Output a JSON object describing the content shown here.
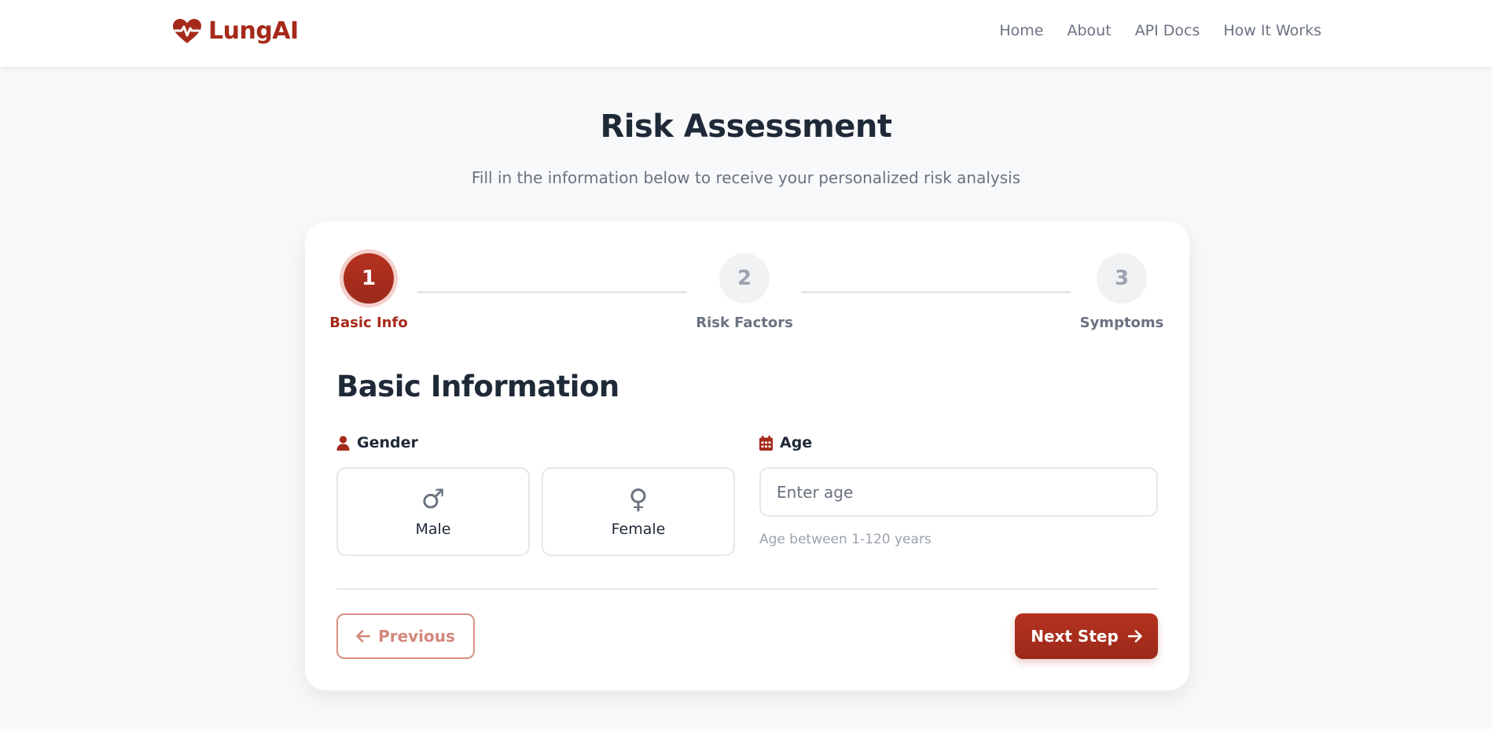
{
  "navbar": {
    "brand": "LungAI",
    "brand_icon": "heart-pulse-icon",
    "brand_color": "#a52a1a",
    "links": [
      {
        "label": "Home"
      },
      {
        "label": "About"
      },
      {
        "label": "API Docs"
      },
      {
        "label": "How It Works"
      }
    ]
  },
  "page": {
    "title": "Risk Assessment",
    "subtitle": "Fill in the information below to receive your personalized risk analysis"
  },
  "stepper": {
    "current_step": 1,
    "steps": [
      {
        "number": "1",
        "label": "Basic Info",
        "state": "active"
      },
      {
        "number": "2",
        "label": "Risk Factors",
        "state": "inactive"
      },
      {
        "number": "3",
        "label": "Symptoms",
        "state": "inactive"
      }
    ]
  },
  "form": {
    "section_title": "Basic Information",
    "gender": {
      "label": "Gender",
      "icon": "user-icon",
      "options": [
        {
          "label": "Male",
          "icon": "♂"
        },
        {
          "label": "Female",
          "icon": "♀"
        }
      ]
    },
    "age": {
      "label": "Age",
      "icon": "calendar-icon",
      "value": "",
      "placeholder": "Enter age",
      "hint": "Age between 1-120 years"
    }
  },
  "actions": {
    "previous_label": "Previous",
    "next_label": "Next Step"
  },
  "colors": {
    "accent": "#a52a1a",
    "accent_light": "#f3d0cb",
    "background": "#f8f9fb"
  }
}
